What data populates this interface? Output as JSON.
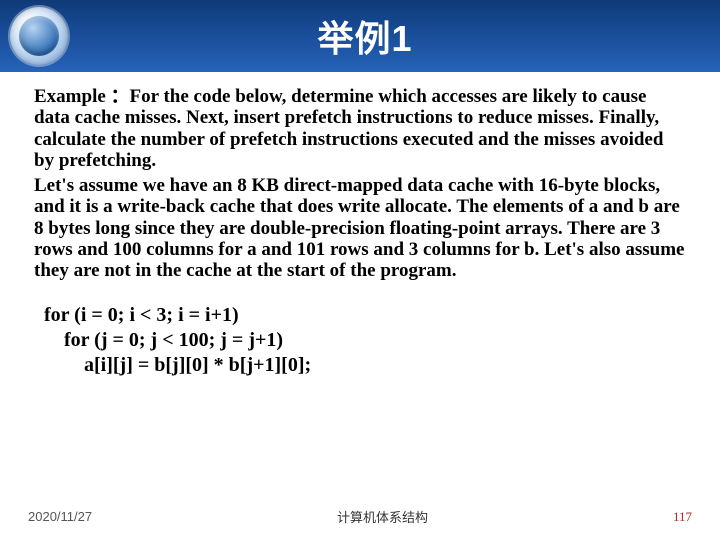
{
  "header": {
    "title": "举例1"
  },
  "body": {
    "para1": "Example ：For the code below, determine which accesses are likely to cause data cache misses. Next, insert prefetch instructions to reduce misses. Finally, calculate the number of prefetch instructions executed and the misses avoided by prefetching.",
    "para2": "Let's assume we have an 8 KB direct-mapped data cache with 16-byte blocks, and it is a write-back cache that does write allocate. The elements of a and b are 8 bytes long since they are double-precision floating-point arrays. There are 3 rows and 100 columns for a and 101 rows and 3 columns for b. Let's also assume they are not in the cache at the start of the program.",
    "code_line1": "for (i = 0; i < 3; i = i+1)",
    "code_line2": "    for (j = 0; j < 100; j = j+1)",
    "code_line3": "        a[i][j] = b[j][0] * b[j+1][0];"
  },
  "footer": {
    "date": "2020/11/27",
    "center": "计算机体系结构",
    "page": "117"
  }
}
